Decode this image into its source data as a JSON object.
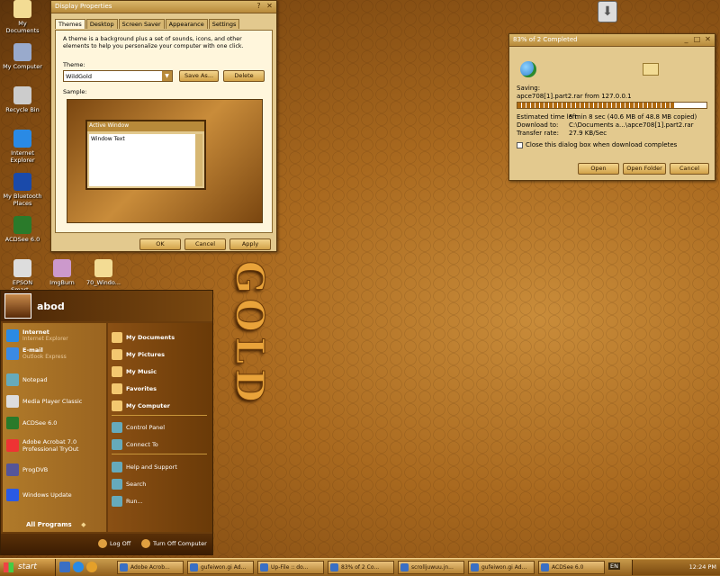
{
  "desktop": {
    "icons": [
      {
        "label": "My Documents",
        "name": "my-documents-icon"
      },
      {
        "label": "My Computer",
        "name": "my-computer-icon"
      },
      {
        "label": "Recycle Bin",
        "name": "recycle-bin-icon"
      },
      {
        "label": "Internet Explorer",
        "name": "internet-explorer-icon"
      },
      {
        "label": "My Bluetooth Places",
        "name": "bluetooth-icon"
      },
      {
        "label": "ACDSee 6.0",
        "name": "acdsee-icon"
      },
      {
        "label": "EPSON Smart...",
        "name": "epson-icon"
      },
      {
        "label": "ImgBurn",
        "name": "imgburn-icon"
      },
      {
        "label": "70_Windo...",
        "name": "folder-icon"
      }
    ],
    "logo": "GOLD"
  },
  "display": {
    "title": "Display Properties",
    "tabs": [
      "Themes",
      "Desktop",
      "Screen Saver",
      "Appearance",
      "Settings"
    ],
    "desc": "A theme is a background plus a set of sounds, icons, and other elements to help you personalize your computer with one click.",
    "theme_label": "Theme:",
    "theme_value": "WildGold",
    "save_as": "Save As...",
    "delete": "Delete",
    "sample_label": "Sample:",
    "sample_title": "Active Window",
    "sample_text": "Window Text",
    "ok": "OK",
    "cancel": "Cancel",
    "apply": "Apply"
  },
  "download": {
    "title": "83% of 2 Completed",
    "saving": "Saving:",
    "file": "apce708[1].part2.rar from 127.0.0.1",
    "progress": 0.83,
    "rows": [
      {
        "k": "Estimated time left:",
        "v": "5 min 8 sec (40.6 MB of 48.8 MB copied)"
      },
      {
        "k": "Download to:",
        "v": "C:\\Documents a...\\apce708[1].part2.rar"
      },
      {
        "k": "Transfer rate:",
        "v": "27.9 KB/Sec"
      }
    ],
    "close_check": "Close this dialog box when download completes",
    "open": "Open",
    "open_folder": "Open Folder",
    "cancel": "Cancel"
  },
  "start_menu": {
    "user": "abod",
    "left": [
      {
        "label": "Internet",
        "sub": "Internet Explorer",
        "name": "ie"
      },
      {
        "label": "E-mail",
        "sub": "Outlook Express",
        "name": "email"
      },
      {
        "label": "Notepad",
        "sub": "",
        "name": "notepad"
      },
      {
        "label": "Media Player Classic",
        "sub": "",
        "name": "mpc"
      },
      {
        "label": "ACDSee 6.0",
        "sub": "",
        "name": "acdsee"
      },
      {
        "label": "Adobe Acrobat 7.0 Professional TryOut",
        "sub": "",
        "name": "acrobat"
      },
      {
        "label": "ProgDVB",
        "sub": "",
        "name": "progdvb"
      },
      {
        "label": "Windows Update",
        "sub": "",
        "name": "windows-update"
      }
    ],
    "all_programs": "All Programs",
    "right": [
      {
        "label": "My Documents",
        "name": "my-documents"
      },
      {
        "label": "My Pictures",
        "name": "my-pictures"
      },
      {
        "label": "My Music",
        "name": "my-music"
      },
      {
        "label": "Favorites",
        "name": "favorites"
      },
      {
        "label": "My Computer",
        "name": "my-computer"
      },
      {
        "label": "Control Panel",
        "name": "control-panel"
      },
      {
        "label": "Connect To",
        "name": "connect-to"
      },
      {
        "label": "Help and Support",
        "name": "help"
      },
      {
        "label": "Search",
        "name": "search"
      },
      {
        "label": "Run...",
        "name": "run"
      }
    ],
    "log_off": "Log Off",
    "turn_off": "Turn Off Computer"
  },
  "taskbar": {
    "start": "start",
    "items": [
      "Adobe Acrob...",
      "gufeiwon.gi Ad...",
      "Up-File :: do...",
      "83% of 2 Co...",
      "scrolljuwuu.jn...",
      "gufeiwon.gi Ad...",
      "ACDSee 6.0"
    ],
    "lang": "EN",
    "clock": "12:24 PM"
  },
  "colors": {
    "accent": "#c98c3a",
    "dark": "#5b330c"
  }
}
